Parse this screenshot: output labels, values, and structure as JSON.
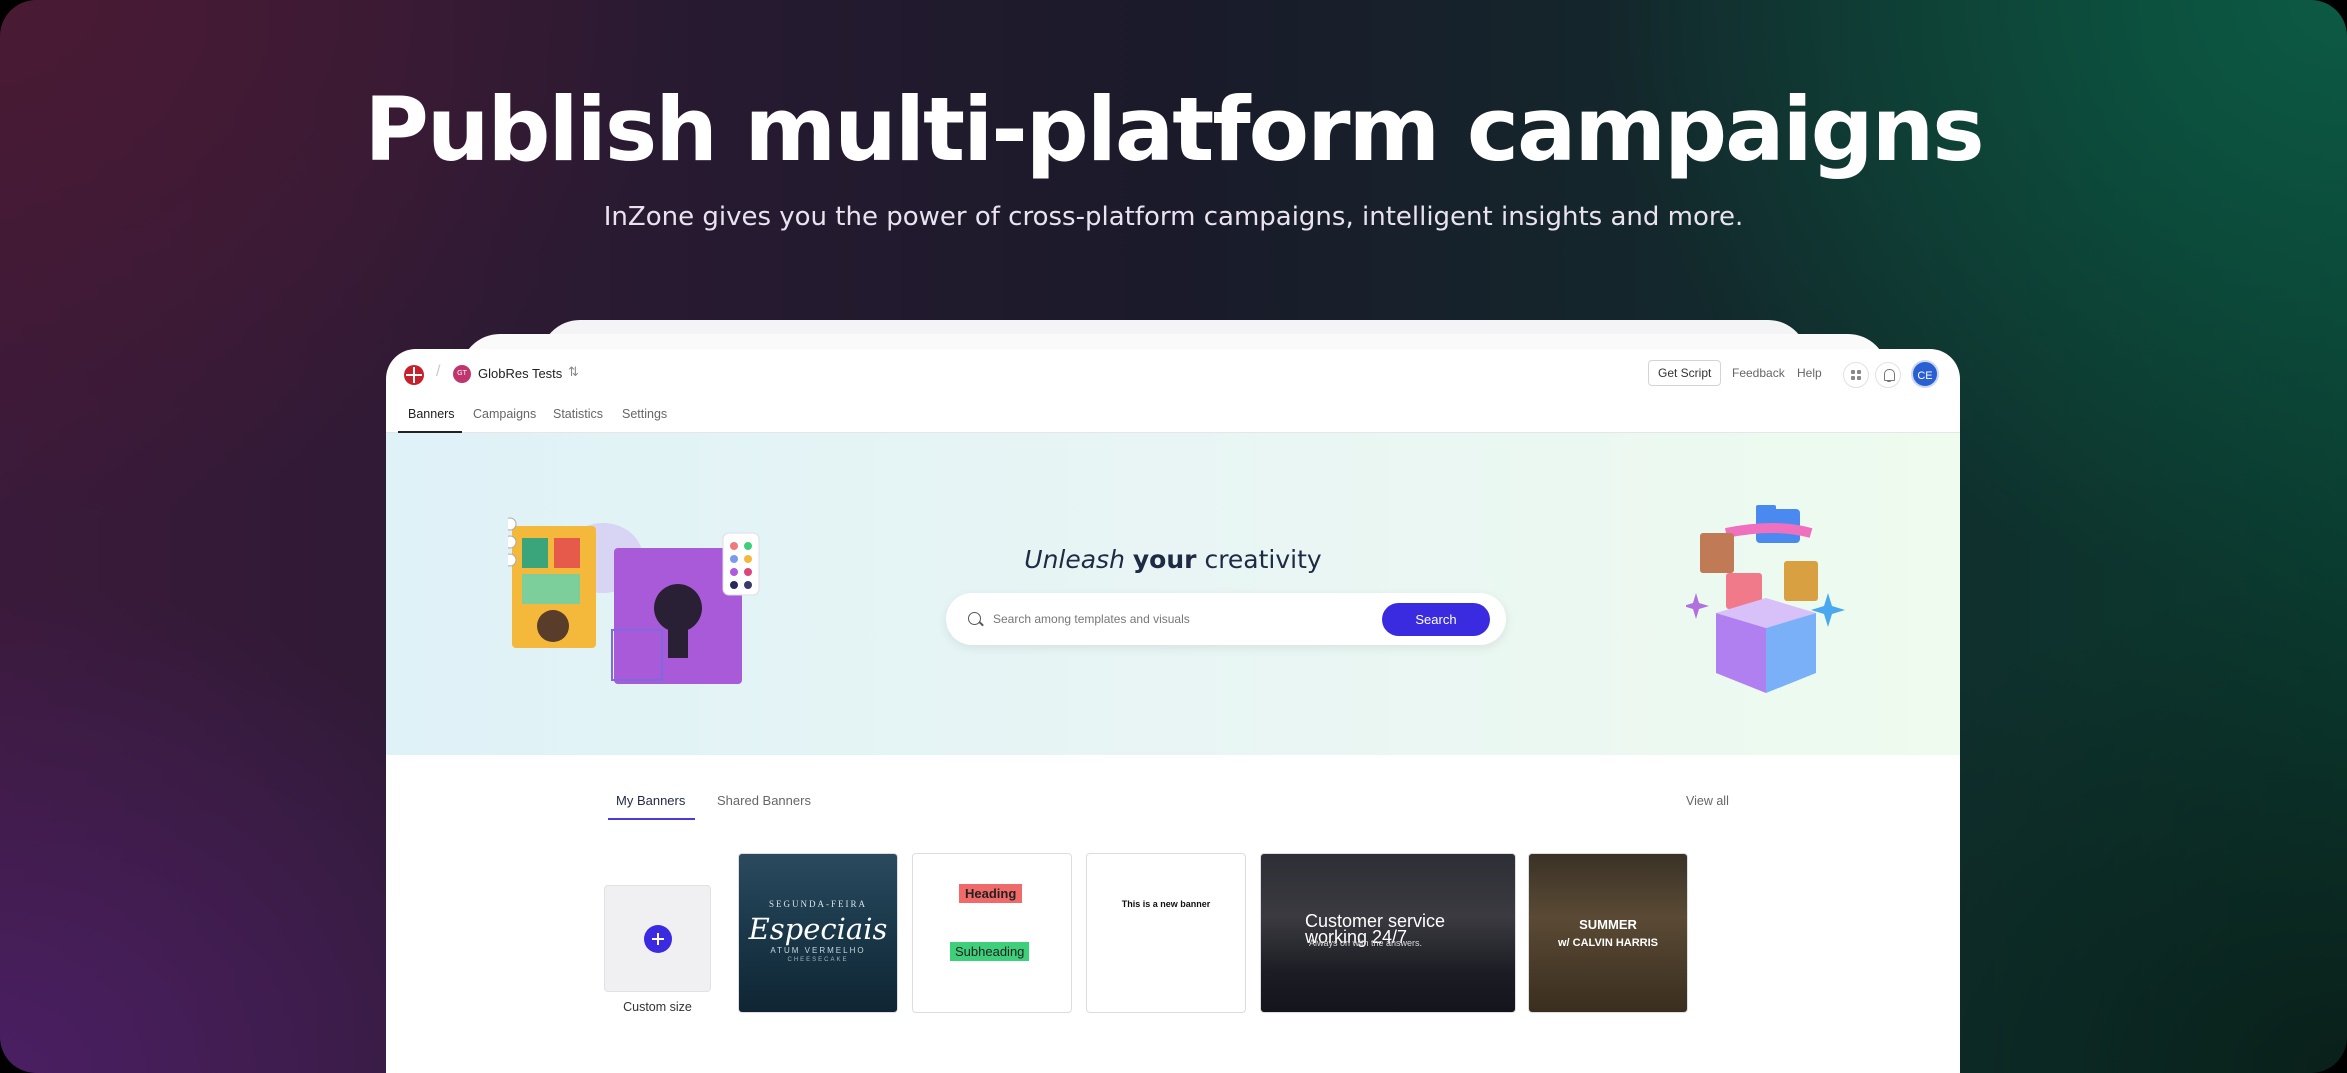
{
  "hero": {
    "title": "Publish multi-platform campaigns",
    "subtitle": "InZone gives you the power of cross-platform campaigns, intelligent insights and more."
  },
  "topbar": {
    "workspace_initials": "GT",
    "workspace_name": "GlobRes Tests",
    "get_script": "Get Script",
    "feedback": "Feedback",
    "help": "Help",
    "user_initials": "CE"
  },
  "nav": {
    "tabs": [
      "Banners",
      "Campaigns",
      "Statistics",
      "Settings"
    ],
    "active": "Banners"
  },
  "hero_banner": {
    "headline_italic": "Unleash",
    "headline_bold": "your",
    "headline_rest": "creativity",
    "search_placeholder": "Search among templates and visuals",
    "search_button": "Search"
  },
  "banners": {
    "tabs": [
      "My Banners",
      "Shared Banners"
    ],
    "active_tab": "My Banners",
    "view_all": "View all",
    "custom_size_label": "Custom size",
    "cards": [
      {
        "line1": "SEGUNDA-FEIRA",
        "line2": "Especiais",
        "line3": "ATUM VERMELHO",
        "line4": "CHEESECAKE"
      },
      {
        "heading": "Heading",
        "subheading": "Subheading"
      },
      {
        "text": "This is a new banner"
      },
      {
        "line1": "Customer service",
        "line2": "working 24/7",
        "line3": "Always on with the answers."
      },
      {
        "line1": "SUMMER",
        "line2": "w/ CALVIN HARRIS"
      }
    ]
  },
  "colors": {
    "accent": "#3b2be0",
    "logo": "#c8202a",
    "user_avatar": "#2a5fd1",
    "workspace_avatar": "#c0356d"
  }
}
